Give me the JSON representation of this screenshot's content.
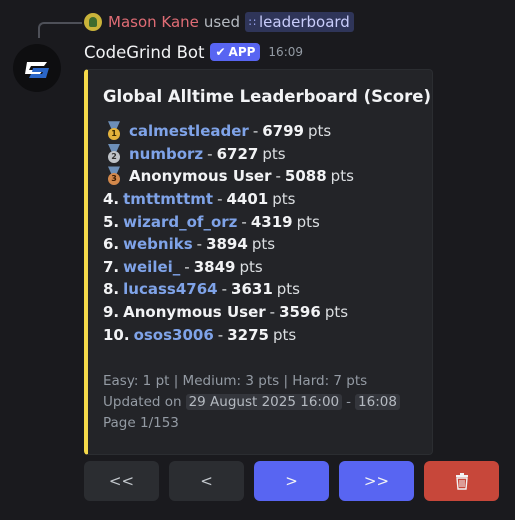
{
  "reply": {
    "username": "Mason Kane",
    "used_text": "used",
    "command": "leaderboard",
    "command_icon": "slash-command-icon"
  },
  "message": {
    "bot_name": "CodeGrind Bot",
    "app_badge": "APP",
    "time": "16:09"
  },
  "embed": {
    "accent_color": "#f5d94a",
    "title": "Global Alltime Leaderboard (Score)",
    "entries": [
      {
        "rank": "",
        "medal": "gold",
        "medal_num": "1",
        "name": "calmestleader",
        "linked": true,
        "score": "6799",
        "unit": "pts"
      },
      {
        "rank": "",
        "medal": "silver",
        "medal_num": "2",
        "name": "numborz",
        "linked": true,
        "score": "6727",
        "unit": "pts"
      },
      {
        "rank": "",
        "medal": "bronze",
        "medal_num": "3",
        "name": "Anonymous User",
        "linked": false,
        "score": "5088",
        "unit": "pts"
      },
      {
        "rank": "4.",
        "name": "tmttmttmt",
        "linked": true,
        "score": "4401",
        "unit": "pts"
      },
      {
        "rank": "5.",
        "name": "wizard_of_orz",
        "linked": true,
        "score": "4319",
        "unit": "pts"
      },
      {
        "rank": "6.",
        "name": "webniks",
        "linked": true,
        "score": "3894",
        "unit": "pts"
      },
      {
        "rank": "7.",
        "name": "weilei_",
        "linked": true,
        "score": "3849",
        "unit": "pts"
      },
      {
        "rank": "8.",
        "name": "lucass4764",
        "linked": true,
        "score": "3631",
        "unit": "pts"
      },
      {
        "rank": "9.",
        "name": "Anonymous User",
        "linked": false,
        "score": "3596",
        "unit": "pts"
      },
      {
        "rank": "10.",
        "name": "osos3006",
        "linked": true,
        "score": "3275",
        "unit": "pts"
      }
    ],
    "points_info": "Easy: 1 pt | Medium: 3 pts | Hard: 7 pts",
    "updated_prefix": "Updated on",
    "updated_date": "29 August 2025 16:00",
    "updated_sep": "-",
    "updated_time": "16:08",
    "page": "Page 1/153"
  },
  "buttons": {
    "first": "<<",
    "prev": "<",
    "next": ">",
    "last": ">>",
    "delete_icon": "trash-icon"
  }
}
